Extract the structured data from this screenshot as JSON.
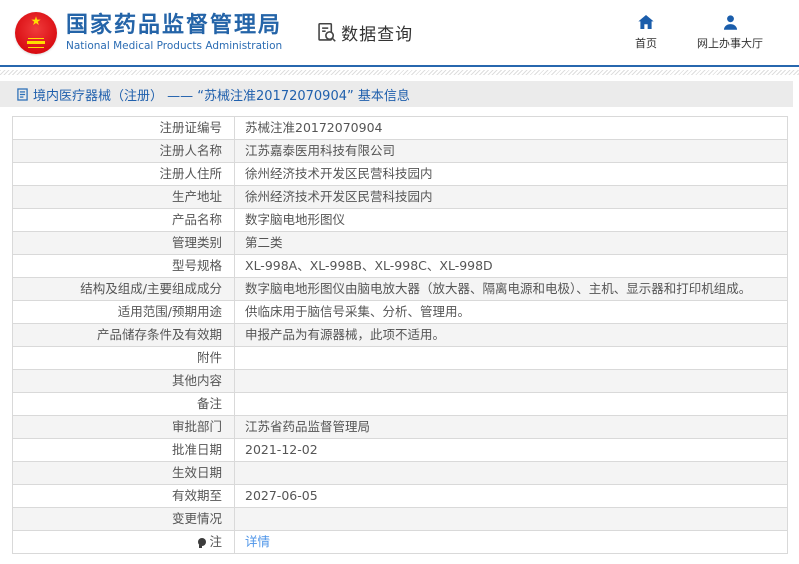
{
  "colors": {
    "brand_blue": "#2464a8",
    "header_rule_blue": "#2767ae",
    "link_blue": "#4d94e8",
    "emblem_red": "#d80a10",
    "emblem_gold": "#ffde00",
    "breadcrumb_bg": "#ebebeb",
    "row_alt_bg": "#f4f4f4"
  },
  "header": {
    "title": "国家药品监督管理局",
    "subtitle": "National Medical Products Administration",
    "module_label": "数据查询",
    "nav": [
      {
        "icon": "home-icon",
        "label": "首页"
      },
      {
        "icon": "user-icon",
        "label": "网上办事大厅"
      }
    ]
  },
  "breadcrumb": {
    "text": "境内医疗器械（注册） ——  “苏械注准20172070904”  基本信息"
  },
  "table": {
    "rows": [
      {
        "label": "注册证编号",
        "value": "苏械注准20172070904"
      },
      {
        "label": "注册人名称",
        "value": "江苏嘉泰医用科技有限公司"
      },
      {
        "label": "注册人住所",
        "value": "徐州经济技术开发区民营科技园内"
      },
      {
        "label": "生产地址",
        "value": "徐州经济技术开发区民营科技园内"
      },
      {
        "label": "产品名称",
        "value": "数字脑电地形图仪"
      },
      {
        "label": "管理类别",
        "value": "第二类"
      },
      {
        "label": "型号规格",
        "value": "XL-998A、XL-998B、XL-998C、XL-998D"
      },
      {
        "label": "结构及组成/主要组成成分",
        "value": "数字脑电地形图仪由脑电放大器（放大器、隔离电源和电极）、主机、显示器和打印机组成。"
      },
      {
        "label": "适用范围/预期用途",
        "value": "供临床用于脑信号采集、分析、管理用。"
      },
      {
        "label": "产品储存条件及有效期",
        "value": "申报产品为有源器械，此项不适用。"
      },
      {
        "label": "附件",
        "value": ""
      },
      {
        "label": "其他内容",
        "value": ""
      },
      {
        "label": "备注",
        "value": ""
      },
      {
        "label": "审批部门",
        "value": "江苏省药品监督管理局"
      },
      {
        "label": "批准日期",
        "value": "2021-12-02"
      },
      {
        "label": "生效日期",
        "value": ""
      },
      {
        "label": "有效期至",
        "value": "2027-06-05"
      },
      {
        "label": "变更情况",
        "value": ""
      },
      {
        "label": "注",
        "label_icon": "bulb-icon",
        "value": "详情",
        "value_is_link": true
      }
    ]
  }
}
